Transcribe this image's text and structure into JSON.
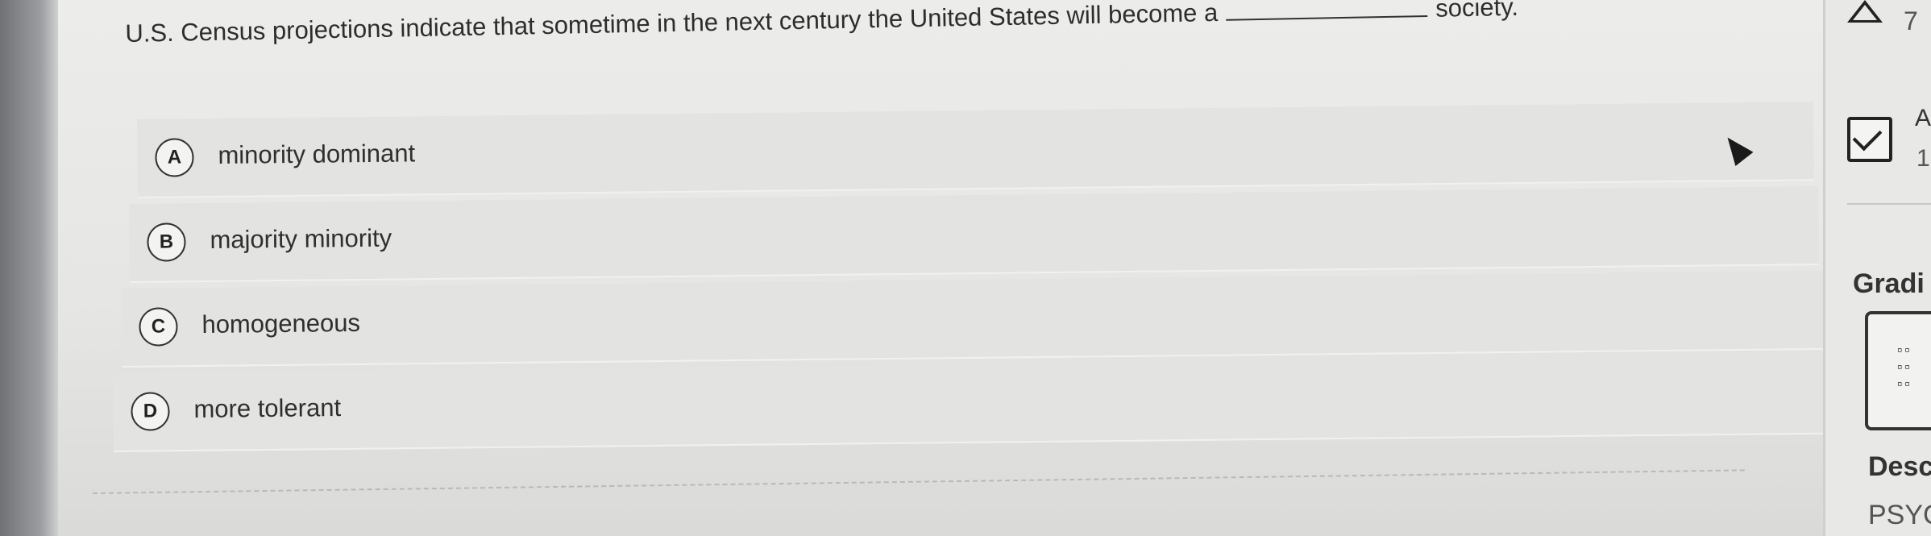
{
  "question": {
    "text_before": "U.S. Census projections indicate that sometime in the next century the United States will become a",
    "text_after": "society."
  },
  "options": [
    {
      "letter": "A",
      "label": "minority dominant"
    },
    {
      "letter": "B",
      "label": "majority minority"
    },
    {
      "letter": "C",
      "label": "homogeneous"
    },
    {
      "letter": "D",
      "label": "more tolerant"
    }
  ],
  "sidebar": {
    "top_number": "7",
    "check_label": "A",
    "check_sub": "1",
    "grading_label": "Gradi",
    "desc_label": "Desc",
    "desc_value": "PSYC"
  },
  "icons": {
    "triangle": "triangle-warning-icon",
    "check": "checkbox-checked-icon",
    "calculator": "calculator-icon",
    "cursor": "mouse-pointer-icon"
  }
}
